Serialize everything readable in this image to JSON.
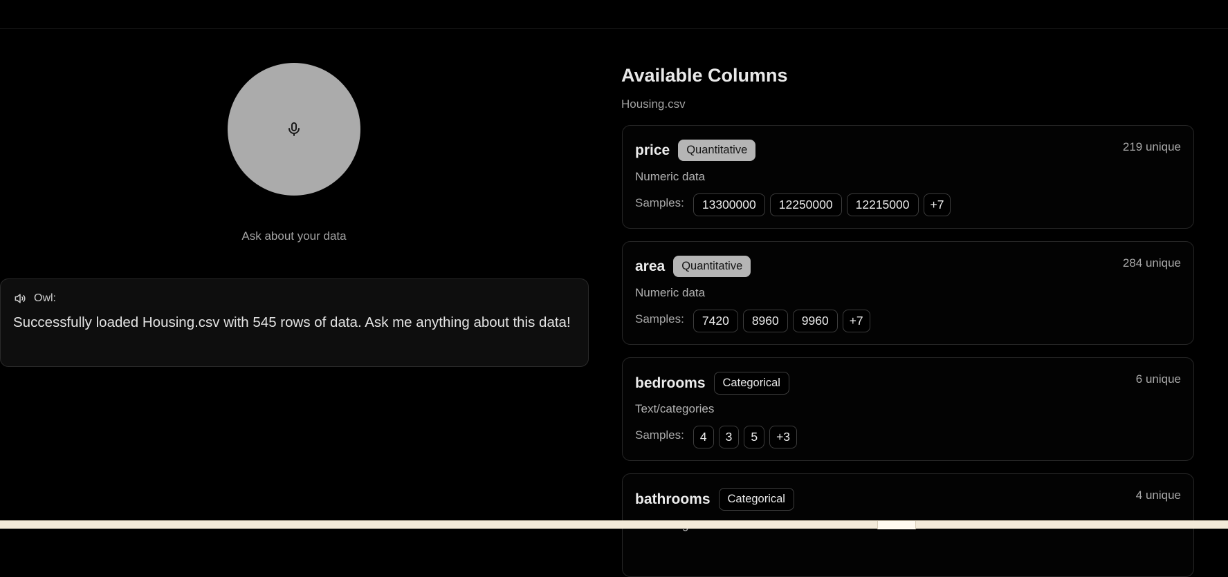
{
  "voice": {
    "prompt_label": "Ask about your data"
  },
  "message": {
    "speaker": "Owl:",
    "text": "Successfully loaded Housing.csv with 545 rows of data. Ask me anything about this data!"
  },
  "columns_panel": {
    "title": "Available Columns",
    "file_name": "Housing.csv",
    "samples_label": "Samples:",
    "columns": [
      {
        "name": "price",
        "type": "Quantitative",
        "description": "Numeric data",
        "unique": "219 unique",
        "samples": [
          "13300000",
          "12250000",
          "12215000"
        ],
        "more": "+7"
      },
      {
        "name": "area",
        "type": "Quantitative",
        "description": "Numeric data",
        "unique": "284 unique",
        "samples": [
          "7420",
          "8960",
          "9960"
        ],
        "more": "+7"
      },
      {
        "name": "bedrooms",
        "type": "Categorical",
        "description": "Text/categories",
        "unique": "6 unique",
        "samples": [
          "4",
          "3",
          "5"
        ],
        "more": "+3"
      },
      {
        "name": "bathrooms",
        "type": "Categorical",
        "description": "Text/categories",
        "unique": "4 unique"
      }
    ]
  }
}
